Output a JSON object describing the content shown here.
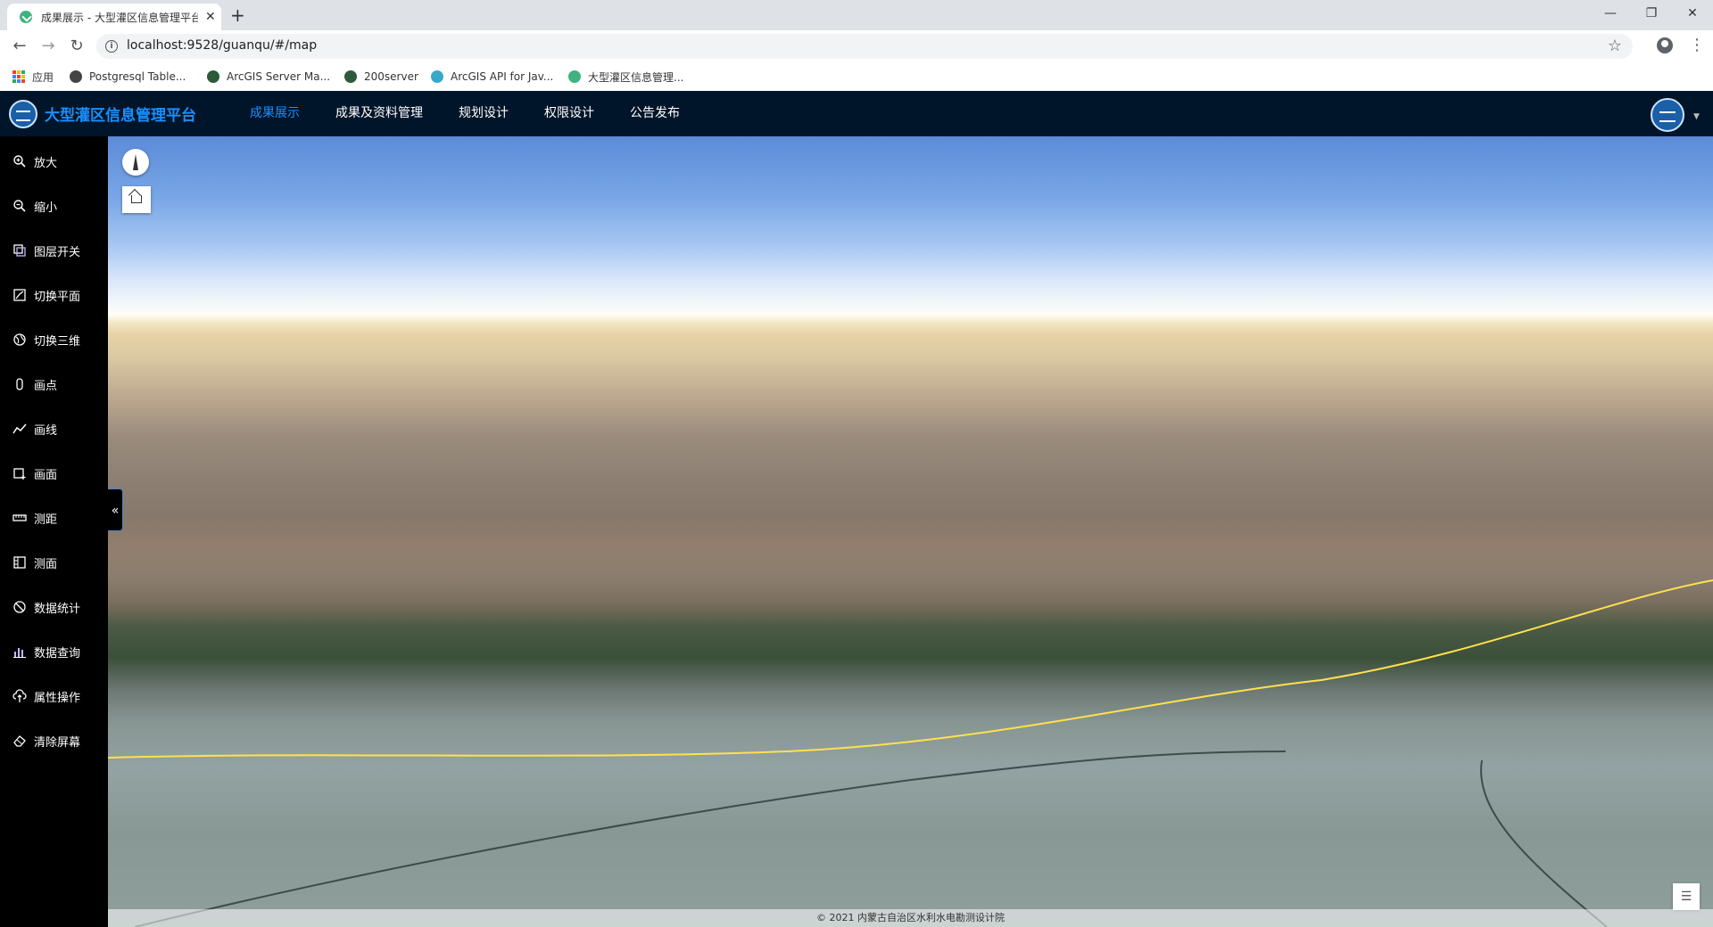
{
  "browser": {
    "tab_title": "成果展示 - 大型灌区信息管理平台",
    "tab_close": "✕",
    "new_tab": "+",
    "window_controls": {
      "minimize": "—",
      "restore": "❐",
      "close": "✕"
    },
    "url": "localhost:9528/guanqu/#/map",
    "bookmarks": [
      {
        "label": "应用",
        "icon": "apps-icon"
      },
      {
        "label": "Postgresql Table...",
        "icon": "globe-icon"
      },
      {
        "label": "ArcGIS Server Ma...",
        "icon": "globe-icon"
      },
      {
        "label": "200server",
        "icon": "globe-icon"
      },
      {
        "label": "ArcGIS API for Jav...",
        "icon": "arcgis-icon"
      },
      {
        "label": "大型灌区信息管理...",
        "icon": "vue-icon"
      }
    ]
  },
  "header": {
    "title": "大型灌区信息管理平台",
    "menu": [
      {
        "label": "成果展示",
        "active": true
      },
      {
        "label": "成果及资料管理",
        "active": false
      },
      {
        "label": "规划设计",
        "active": false
      },
      {
        "label": "权限设计",
        "active": false
      },
      {
        "label": "公告发布",
        "active": false
      }
    ],
    "active_color": "#1890ff",
    "background": "#001529"
  },
  "toolbar": [
    {
      "label": "放大",
      "icon": "zoom-in-icon"
    },
    {
      "label": "缩小",
      "icon": "zoom-out-icon"
    },
    {
      "label": "图层开关",
      "icon": "layers-icon"
    },
    {
      "label": "切换平面",
      "icon": "map-2d-icon"
    },
    {
      "label": "切换三维",
      "icon": "globe-3d-icon"
    },
    {
      "label": "画点",
      "icon": "point-icon"
    },
    {
      "label": "画线",
      "icon": "polyline-icon"
    },
    {
      "label": "画面",
      "icon": "polygon-icon"
    },
    {
      "label": "测距",
      "icon": "ruler-icon"
    },
    {
      "label": "测面",
      "icon": "area-measure-icon"
    },
    {
      "label": "数据统计",
      "icon": "stats-icon"
    },
    {
      "label": "数据查询",
      "icon": "bar-chart-icon"
    },
    {
      "label": "属性操作",
      "icon": "cloud-upload-icon"
    },
    {
      "label": "清除屏幕",
      "icon": "eraser-icon"
    }
  ],
  "map": {
    "collapse_glyph": "«",
    "legend_glyph": "☰",
    "attribution": "© 2021 内蒙古自治区水利水电勘测设计院"
  }
}
